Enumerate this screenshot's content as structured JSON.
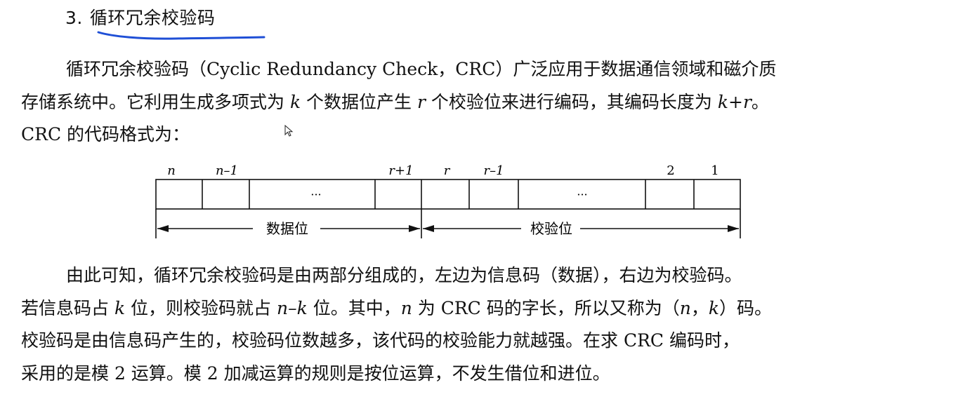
{
  "heading": {
    "number": "3.",
    "title": "循环冗余校验码"
  },
  "intro": {
    "line1": "循环冗余校验码（Cyclic Redundancy Check，CRC）广泛应用于数据通信领域和磁介质",
    "line2_a": "存储系统中。它利用生成多项式为 ",
    "var_k": "k",
    "line2_b": " 个数据位产生 ",
    "var_r": "r",
    "line2_c": " 个校验位来进行编码，其编码长度为 ",
    "var_kr": "k+r",
    "line2_d": "。",
    "line3": "CRC 的代码格式为："
  },
  "diagram": {
    "bit_labels": {
      "n": "n",
      "n_minus_1": "n–1",
      "r_plus_1": "r+1",
      "r": "r",
      "r_minus_1": "r–1",
      "two": "2",
      "one": "1"
    },
    "ellipsis": "···",
    "data_label": "数据位",
    "check_label": "校验位"
  },
  "body": {
    "l1": "由此可知，循环冗余校验码是由两部分组成的，左边为信息码（数据），右边为校验码。",
    "l2_a": "若信息码占 ",
    "l2_k": "k",
    "l2_b": " 位，则校验码就占 ",
    "l2_nk": "n–k",
    "l2_c": " 位。其中，",
    "l2_n": "n",
    "l2_d": " 为 CRC 码的字长，所以又称为（",
    "l2_n2": "n",
    "l2_comma": "，",
    "l2_k2": "k",
    "l2_e": "）码。",
    "l3": "校验码是由信息码产生的，校验码位数越多，该代码的校验能力就越强。在求 CRC 编码时，",
    "l4": "采用的是模 2 运算。模 2 加减运算的规则是按位运算，不发生借位和进位。"
  }
}
